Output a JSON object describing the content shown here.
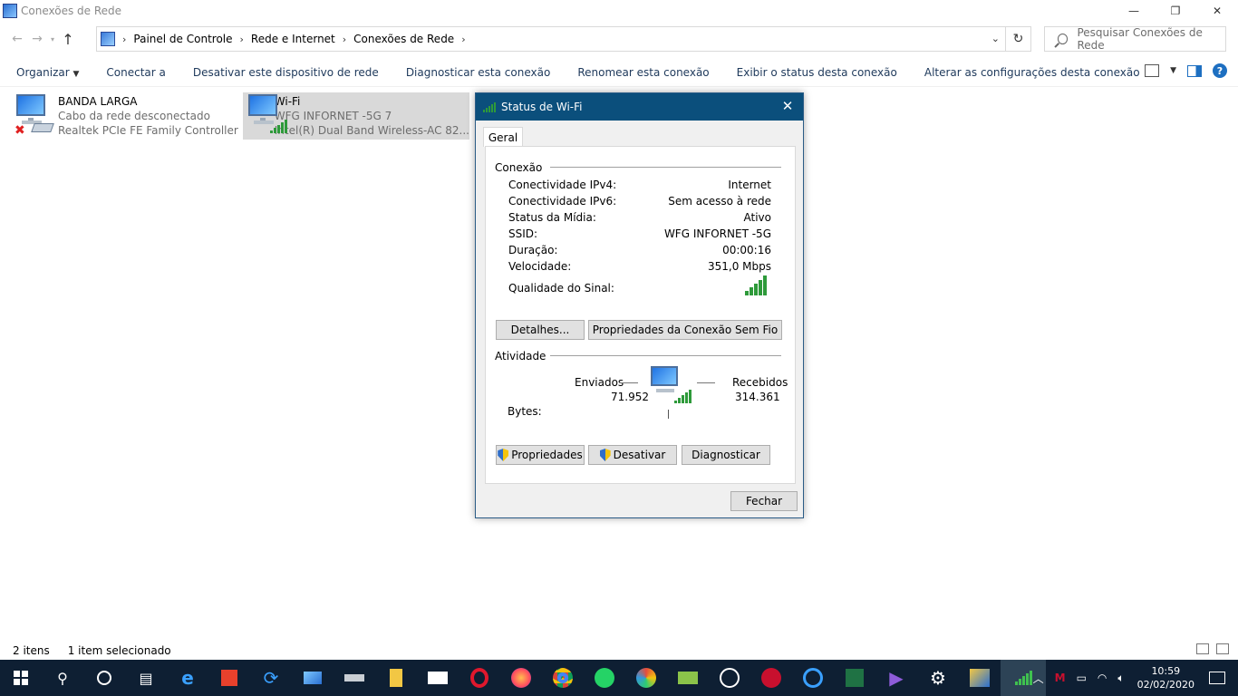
{
  "window": {
    "title": "Conexões de Rede",
    "minimize": "—",
    "restore": "❐",
    "close": "✕"
  },
  "address": {
    "breadcrumbs": [
      "Painel de Controle",
      "Rede e Internet",
      "Conexões de Rede"
    ],
    "search_placeholder": "Pesquisar Conexões de Rede"
  },
  "commands": {
    "organize": "Organizar",
    "connect": "Conectar a",
    "disable": "Desativar este dispositivo de rede",
    "diagnose": "Diagnosticar esta conexão",
    "rename": "Renomear esta conexão",
    "status": "Exibir o status desta conexão",
    "settings": "Alterar as configurações desta conexão"
  },
  "connections": [
    {
      "name": "BANDA LARGA",
      "status": "Cabo da rede desconectado",
      "adapter": "Realtek PCIe FE Family Controller"
    },
    {
      "name": "Wi-Fi",
      "status": "WFG INFORNET -5G 7",
      "adapter": "Intel(R) Dual Band Wireless-AC 82..."
    }
  ],
  "dialog": {
    "title": "Status de Wi-Fi",
    "tab": "Geral",
    "connection_label": "Conexão",
    "rows": [
      {
        "label": "Conectividade IPv4:",
        "value": "Internet"
      },
      {
        "label": "Conectividade IPv6:",
        "value": "Sem acesso à rede"
      },
      {
        "label": "Status da Mídia:",
        "value": "Ativo"
      },
      {
        "label": "SSID:",
        "value": "WFG INFORNET -5G"
      },
      {
        "label": "Duração:",
        "value": "00:00:16"
      },
      {
        "label": "Velocidade:",
        "value": "351,0 Mbps"
      }
    ],
    "signal_label": "Qualidade do Sinal:",
    "signal_bars": 5,
    "details_button": "Detalhes...",
    "wireless_props_button": "Propriedades da Conexão Sem Fio",
    "activity_label": "Atividade",
    "sent_label": "Enviados",
    "received_label": "Recebidos",
    "bytes_label": "Bytes:",
    "bytes_sent": "71.952",
    "bytes_received": "314.361",
    "properties_button": "Propriedades",
    "disable_button": "Desativar",
    "diagnose_button": "Diagnosticar",
    "close_button": "Fechar"
  },
  "statusbar": {
    "items": "2 itens",
    "selected": "1 item selecionado"
  },
  "taskbar": {
    "time": "10:59",
    "date": "02/02/2020"
  },
  "colors": {
    "dialog_title": "#0b4f7c",
    "taskbar": "#0e1f33",
    "signal_green": "#2e9a3a",
    "selection": "#d9d9d9"
  }
}
